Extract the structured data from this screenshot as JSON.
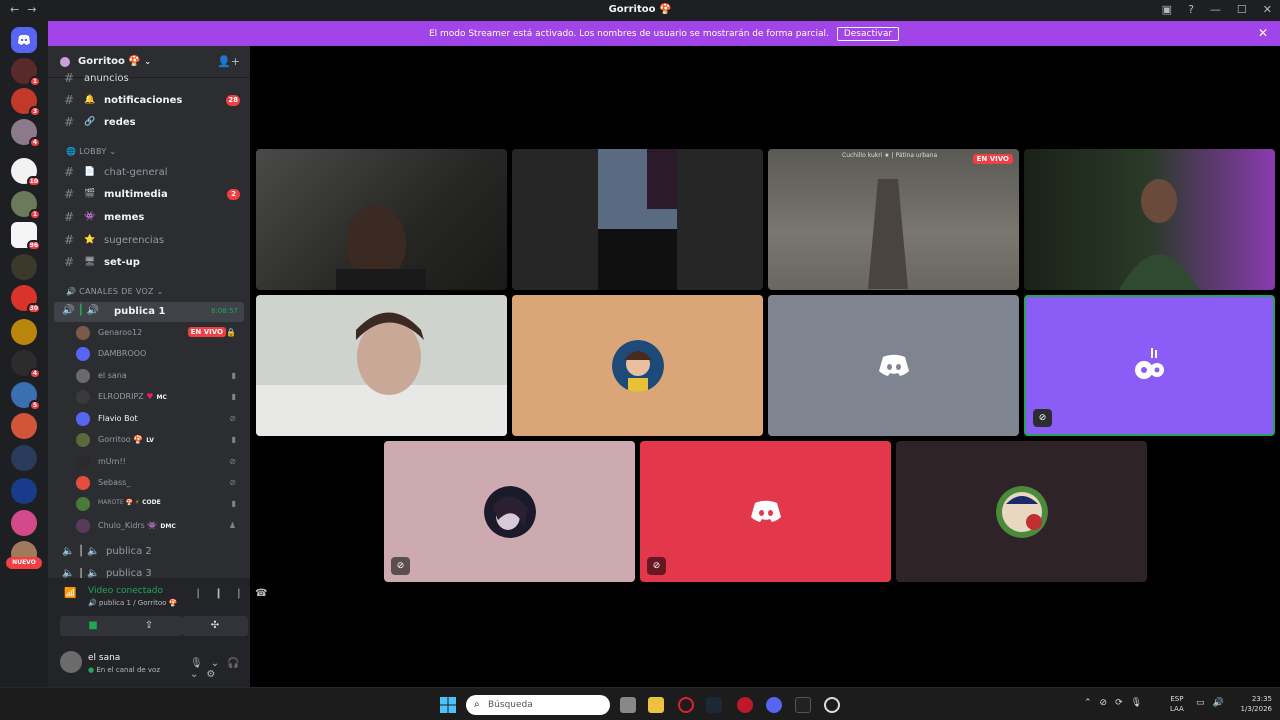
{
  "window": {
    "title": "Gorritoo 🍄",
    "back_icon": "←",
    "forward_icon": "→"
  },
  "banner": {
    "text": "El modo Streamer está activado. Los nombres de usuario se mostrarán de forma parcial.",
    "button": "Desactivar",
    "close": "✕"
  },
  "guild": {
    "name": "Gorritoo 🍄"
  },
  "servers": {
    "badges": [
      "1",
      "3",
      "4",
      "10",
      "1",
      "96",
      "30",
      "4",
      "5"
    ],
    "nuevo": "NUEVO"
  },
  "channels": {
    "top_partial": "anuncios",
    "items": [
      {
        "name": "notificaciones",
        "emoji": "🔔",
        "unread": true,
        "badge": "28"
      },
      {
        "name": "redes",
        "emoji": "🔗",
        "unread": true,
        "badge": ""
      },
      {
        "name": "chat-general",
        "emoji": "📄",
        "unread": false,
        "badge": ""
      },
      {
        "name": "multimedia",
        "emoji": "🎬",
        "unread": true,
        "badge": "2"
      },
      {
        "name": "memes",
        "emoji": "👾",
        "unread": true,
        "badge": ""
      },
      {
        "name": "sugerencias",
        "emoji": "⭐",
        "unread": false,
        "badge": ""
      },
      {
        "name": "set-up",
        "emoji": "🖥",
        "unread": true,
        "badge": ""
      }
    ],
    "category_lobby": "LOBBY",
    "category_voice": "CANALES DE VOZ"
  },
  "voice": {
    "channel": "publica 1",
    "timer": "8:08:57",
    "users": [
      {
        "name": "Genaroo12",
        "tag": "",
        "live": "EN VIVO",
        "status": ""
      },
      {
        "name": "DAMBROOO",
        "tag": "",
        "live": "",
        "status": ""
      },
      {
        "name": "el sana",
        "tag": "",
        "live": "",
        "status": "▮"
      },
      {
        "name": "ELRODRIPZ",
        "tag": "MC",
        "live": "",
        "status": "▮"
      },
      {
        "name": "Flavio Bot",
        "tag": "",
        "live": "",
        "status": "⊘"
      },
      {
        "name": "Gorritoo",
        "tag": "LV",
        "live": "",
        "status": "▮"
      },
      {
        "name": "mUm!!",
        "tag": "",
        "live": "",
        "status": "⊘"
      },
      {
        "name": "Sebass_",
        "tag": "",
        "live": "",
        "status": "⊘"
      },
      {
        "name": "MAROTE",
        "tag": "CODE",
        "live": "",
        "status": "▮"
      },
      {
        "name": "Chulo_Kidrs",
        "tag": "DMC",
        "live": "",
        "status": "♟"
      }
    ],
    "other_channels": [
      "publica 2",
      "publica 3"
    ]
  },
  "panel": {
    "status": "Video conectado",
    "sub": "publica 1 / Gorritoo 🍄",
    "me_name": "el sana",
    "me_status": "En el canal de voz"
  },
  "tiles": {
    "live_label": "EN VIVO",
    "stream_caption": "Cuchillo kukri ★ | Pátina urbana"
  },
  "taskbar": {
    "search_placeholder": "Búsqueda",
    "lang_top": "ESP",
    "lang_bottom": "LAA",
    "time": "23:35",
    "date": "1/3/2026"
  }
}
